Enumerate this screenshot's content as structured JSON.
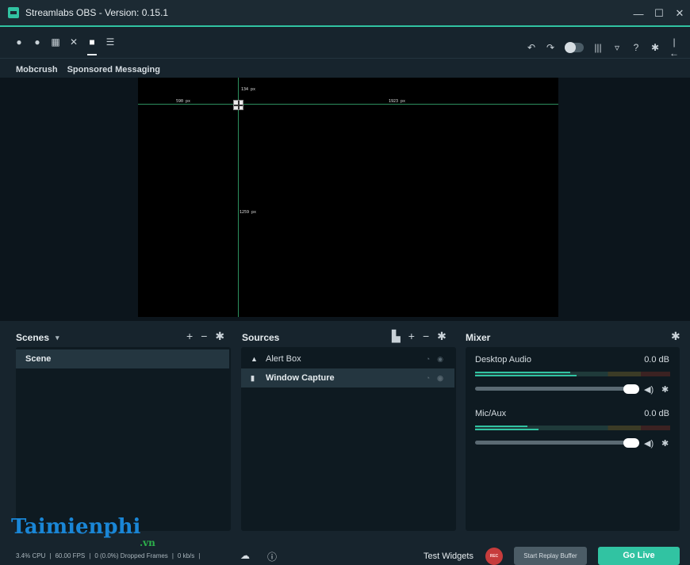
{
  "window": {
    "title": "Streamlabs OBS - Version: 0.15.1"
  },
  "window_controls": {
    "minimize": "—",
    "maximize": "☐",
    "close": "✕"
  },
  "toolbar": {
    "left_icons": [
      "themes-icon",
      "chat-icon",
      "store-icon",
      "tools-icon",
      "editor-icon",
      "settings-list-icon"
    ],
    "right_icons": [
      "undo-icon",
      "redo-icon",
      "studio-mode-toggle",
      "layout-icon",
      "shield-icon",
      "help-icon",
      "settings-icon",
      "logout-icon"
    ]
  },
  "message_bar": {
    "item1": "Mobcrush",
    "item2": "Sponsored Messaging"
  },
  "preview": {
    "dim_top": "134 px",
    "dim_left": "590 px",
    "dim_right": "1923 px",
    "dim_bottom": "1259 px"
  },
  "scenes": {
    "title": "Scenes",
    "items": [
      "Scene"
    ]
  },
  "sources": {
    "title": "Sources",
    "items": [
      {
        "label": "Alert Box",
        "icon": "bell-icon"
      },
      {
        "label": "Window Capture",
        "icon": "file-icon"
      }
    ]
  },
  "mixer": {
    "title": "Mixer",
    "channels": [
      {
        "name": "Desktop Audio",
        "db": "0.0 dB"
      },
      {
        "name": "Mic/Aux",
        "db": "0.0 dB"
      }
    ]
  },
  "footer": {
    "cpu": "3.4% CPU",
    "fps": "60.00 FPS",
    "dropped": "0 (0.0%) Dropped Frames",
    "bandwidth": "0 kb/s",
    "test_widgets": "Test Widgets",
    "rec": "REC",
    "replay_buffer": "Start Replay Buffer",
    "go_live": "Go Live"
  },
  "watermark": {
    "brand": "Taimienphi",
    "suffix": ".vn"
  },
  "colors": {
    "accent": "#31c3a2",
    "background": "#17242d",
    "panel": "#0e1a21",
    "rec": "#c63c3c"
  }
}
